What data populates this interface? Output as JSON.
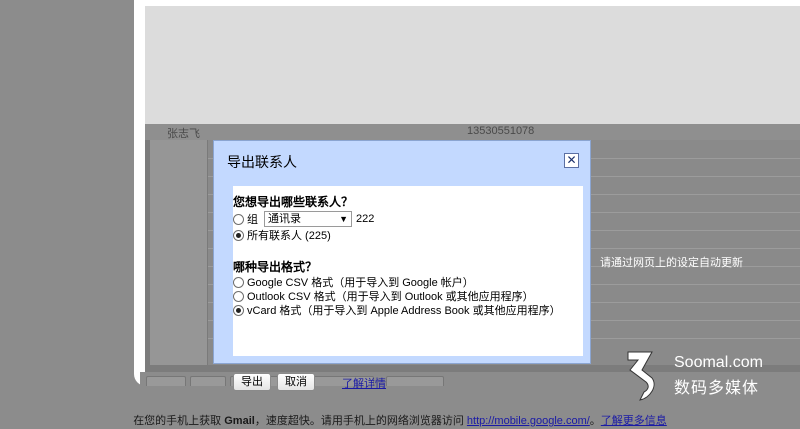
{
  "background": {
    "faded_contact_name": "张志飞",
    "faded_contact_phone": "13530551078",
    "right_note": "请通过网页上的设定自动更新"
  },
  "dialog": {
    "title": "导出联系人",
    "close_icon": "close-x",
    "which_contacts_question": "您想导出哪些联系人？",
    "option_group_label": "组",
    "group_select_value": "通讯录",
    "group_count": "222",
    "option_all_label": "所有联系人 (225)",
    "which_format_question": "哪种导出格式？",
    "format_options": [
      {
        "label": "Google CSV 格式（用于导入到 Google 帐户）",
        "selected": false
      },
      {
        "label": "Outlook CSV 格式（用于导入到 Outlook 或其他应用程序）",
        "selected": false
      },
      {
        "label": "vCard 格式（用于导入到 Apple Address Book 或其他应用程序）",
        "selected": true
      }
    ],
    "export_button": "导出",
    "cancel_button": "取消",
    "learn_more_link": "了解详情"
  },
  "footer": {
    "prefix": "在您的手机上获取 ",
    "brand": "Gmail",
    "middle": "，速度超快。请用手机上的网络浏览器访问 ",
    "url": "http://mobile.google.com/",
    "separator": "。",
    "more_link": "了解更多信息"
  },
  "watermark": {
    "line1": "Soomal.com",
    "line2": "数码多媒体"
  },
  "colors": {
    "dialog_border": "#c3d9ff",
    "link": "#1a1aa6",
    "overlay": "#8c8c8c"
  }
}
